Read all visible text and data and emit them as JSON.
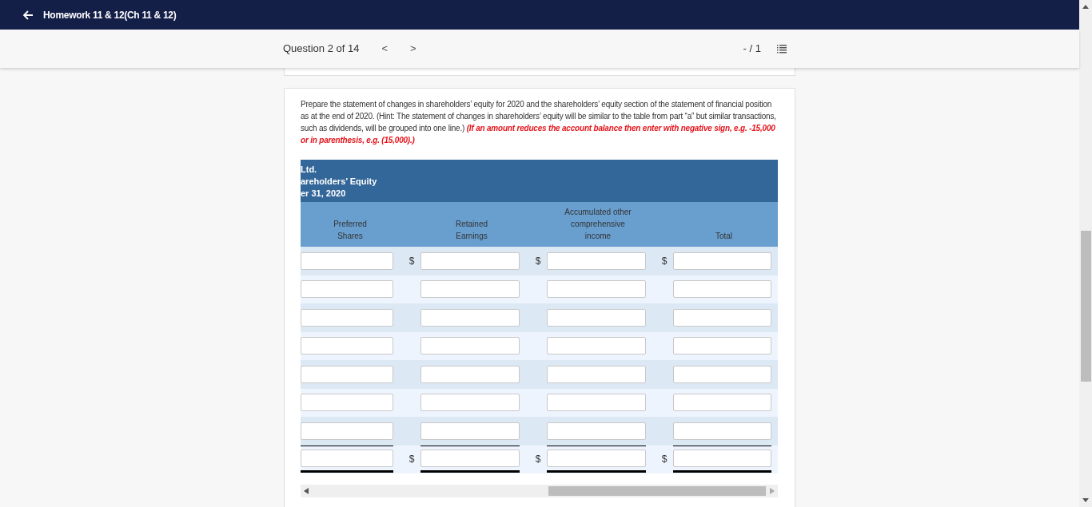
{
  "top_bar": {
    "title": "Homework 11 & 12(Ch 11 & 12)"
  },
  "question_bar": {
    "position": "Question 2 of 14",
    "prev": "<",
    "next": ">",
    "score": "- / 1"
  },
  "question": {
    "text": "Prepare the statement of changes in shareholders’ equity for 2020 and the shareholders’ equity section of the statement of financial position as at the end of 2020. (Hint: The statement of changes in shareholders’ equity will be similar to the table from part “a” but similar transactions, such as dividends, will be grouped into one line.)",
    "note": "(If an amount reduces the account balance then enter with negative sign, e.g. -15,000 or in parenthesis, e.g. (15,000).)"
  },
  "table": {
    "title_lines": [
      "Ltd.",
      "areholders’ Equity",
      "er 31, 2020"
    ],
    "columns": [
      "Preferred\nShares",
      "Retained\nEarnings",
      "Accumulated other\ncomprehensive\nincome",
      "Total"
    ],
    "rows": [
      {
        "kind": "plain",
        "cells": [
          {},
          {
            "prefix": "$"
          },
          {
            "prefix": "$"
          },
          {
            "prefix": "$"
          }
        ]
      },
      {
        "kind": "plain",
        "cells": [
          {},
          {},
          {},
          {}
        ]
      },
      {
        "kind": "plain",
        "cells": [
          {},
          {},
          {},
          {}
        ]
      },
      {
        "kind": "plain",
        "cells": [
          {},
          {},
          {},
          {}
        ]
      },
      {
        "kind": "plain",
        "cells": [
          {},
          {},
          {},
          {}
        ]
      },
      {
        "kind": "plain",
        "cells": [
          {},
          {},
          {},
          {}
        ]
      },
      {
        "kind": "plain",
        "cells": [
          {},
          {},
          {},
          {}
        ]
      },
      {
        "kind": "total",
        "cells": [
          {},
          {
            "prefix": "$"
          },
          {
            "prefix": "$"
          },
          {
            "prefix": "$"
          }
        ]
      }
    ]
  }
}
